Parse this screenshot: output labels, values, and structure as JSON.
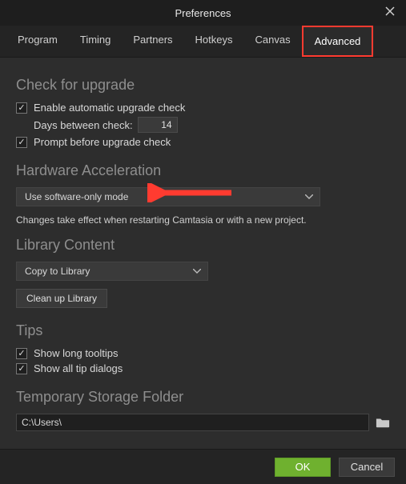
{
  "window": {
    "title": "Preferences"
  },
  "tabs": {
    "program": "Program",
    "timing": "Timing",
    "partners": "Partners",
    "hotkeys": "Hotkeys",
    "canvas": "Canvas",
    "advanced": "Advanced"
  },
  "upgrade": {
    "title": "Check for upgrade",
    "enable": "Enable automatic upgrade check",
    "days_label": "Days between check:",
    "days_value": "14",
    "prompt": "Prompt before upgrade check"
  },
  "hwaccel": {
    "title": "Hardware Acceleration",
    "mode": "Use software-only mode",
    "hint": "Changes take effect when restarting Camtasia or with a new project."
  },
  "library": {
    "title": "Library Content",
    "mode": "Copy to Library",
    "cleanup": "Clean up Library"
  },
  "tips": {
    "title": "Tips",
    "long_tooltips": "Show long tooltips",
    "all_dialogs": "Show all tip dialogs"
  },
  "storage": {
    "title": "Temporary Storage Folder",
    "path": "C:\\Users\\"
  },
  "footer": {
    "ok": "OK",
    "cancel": "Cancel"
  },
  "colors": {
    "accent_highlight": "#ff3b30",
    "ok_button": "#6fb12f"
  }
}
